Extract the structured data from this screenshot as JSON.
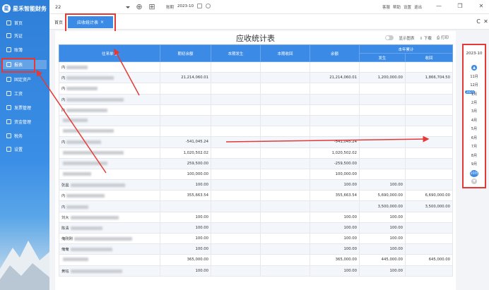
{
  "app": {
    "name": "星禾智能财务"
  },
  "sidebar": {
    "items": [
      {
        "label": "首页"
      },
      {
        "label": "凭证"
      },
      {
        "label": "账簿"
      },
      {
        "label": "报表"
      },
      {
        "label": "固定资产"
      },
      {
        "label": "工资"
      },
      {
        "label": "发票管理"
      },
      {
        "label": "资金管理"
      },
      {
        "label": "税务"
      },
      {
        "label": "设置"
      }
    ]
  },
  "topbar": {
    "account": "22",
    "period_label": "账期",
    "period_value": "2023-10",
    "links": [
      "客服",
      "帮助",
      "设置",
      "退出"
    ]
  },
  "tabs": {
    "home": "首页",
    "active": "应收统计表"
  },
  "report": {
    "title": "应收统计表",
    "tools": {
      "toggle_label": "显示图表",
      "download": "下载",
      "print": "打印"
    },
    "headers": {
      "name": "往来单位",
      "opening": "期初余额",
      "period_incurred": "本期发生",
      "period_received": "本期收回",
      "balance": "余额",
      "year_total": "本年累计",
      "year_incurred": "发生",
      "year_received": "收回"
    },
    "rows": [
      {
        "name": "内",
        "opening": "",
        "incurred": "",
        "received": "",
        "balance": "",
        "y_inc": "",
        "y_rec": ""
      },
      {
        "name": "内",
        "opening": "21,214,060.01",
        "incurred": "",
        "received": "",
        "balance": "21,214,060.01",
        "y_inc": "1,200,000.00",
        "y_rec": "1,866,704.50"
      },
      {
        "name": "内",
        "opening": "",
        "incurred": "",
        "received": "",
        "balance": "",
        "y_inc": "",
        "y_rec": ""
      },
      {
        "name": "内",
        "opening": "",
        "incurred": "",
        "received": "",
        "balance": "",
        "y_inc": "",
        "y_rec": ""
      },
      {
        "name": "内",
        "opening": "",
        "incurred": "",
        "received": "",
        "balance": "",
        "y_inc": "",
        "y_rec": ""
      },
      {
        "name": "",
        "opening": "",
        "incurred": "",
        "received": "",
        "balance": "",
        "y_inc": "",
        "y_rec": ""
      },
      {
        "name": "",
        "opening": "",
        "incurred": "",
        "received": "",
        "balance": "",
        "y_inc": "",
        "y_rec": ""
      },
      {
        "name": "内",
        "opening": "-541,045.24",
        "incurred": "",
        "received": "",
        "balance": "-541,045.24",
        "y_inc": "",
        "y_rec": ""
      },
      {
        "name": "",
        "opening": "1,020,502.02",
        "incurred": "",
        "received": "",
        "balance": "1,020,502.02",
        "y_inc": "",
        "y_rec": ""
      },
      {
        "name": "",
        "opening": "259,500.00",
        "incurred": "",
        "received": "",
        "balance": "-259,500.00",
        "y_inc": "",
        "y_rec": ""
      },
      {
        "name": "",
        "opening": "100,000.00",
        "incurred": "",
        "received": "",
        "balance": "100,000.00",
        "y_inc": "",
        "y_rec": ""
      },
      {
        "name": "张晨",
        "opening": "100.00",
        "incurred": "",
        "received": "",
        "balance": "100.00",
        "y_inc": "100.00",
        "y_rec": ""
      },
      {
        "name": "内",
        "opening": "355,663.54",
        "incurred": "",
        "received": "",
        "balance": "355,663.54",
        "y_inc": "5,690,000.00",
        "y_rec": "6,690,000.00"
      },
      {
        "name": "内",
        "opening": "",
        "incurred": "",
        "received": "",
        "balance": "",
        "y_inc": "3,500,000.00",
        "y_rec": "3,500,000.00"
      },
      {
        "name": "刘大",
        "opening": "100.00",
        "incurred": "",
        "received": "",
        "balance": "100.00",
        "y_inc": "100.00",
        "y_rec": ""
      },
      {
        "name": "陈清",
        "opening": "100.00",
        "incurred": "",
        "received": "",
        "balance": "100.00",
        "y_inc": "100.00",
        "y_rec": ""
      },
      {
        "name": "俺刚刚",
        "opening": "100.00",
        "incurred": "",
        "received": "",
        "balance": "100.00",
        "y_inc": "100.00",
        "y_rec": ""
      },
      {
        "name": "俺俺",
        "opening": "100.00",
        "incurred": "",
        "received": "",
        "balance": "100.00",
        "y_inc": "100.00",
        "y_rec": ""
      },
      {
        "name": "",
        "opening": "365,000.00",
        "incurred": "",
        "received": "",
        "balance": "365,000.00",
        "y_inc": "445,000.00",
        "y_rec": "645,000.00"
      },
      {
        "name": "黄钰",
        "opening": "100.00",
        "incurred": "",
        "received": "",
        "balance": "100.00",
        "y_inc": "100.00",
        "y_rec": ""
      }
    ]
  },
  "date_panel": {
    "year": "2023-10",
    "months": [
      "11月",
      "12月",
      "1月",
      "2月",
      "3月",
      "4月",
      "5月",
      "6月",
      "7月",
      "8月",
      "9月",
      "10月"
    ],
    "year_chip": "2023"
  },
  "colors": {
    "accent": "#3b8ae6",
    "highlight": "#e53935"
  }
}
